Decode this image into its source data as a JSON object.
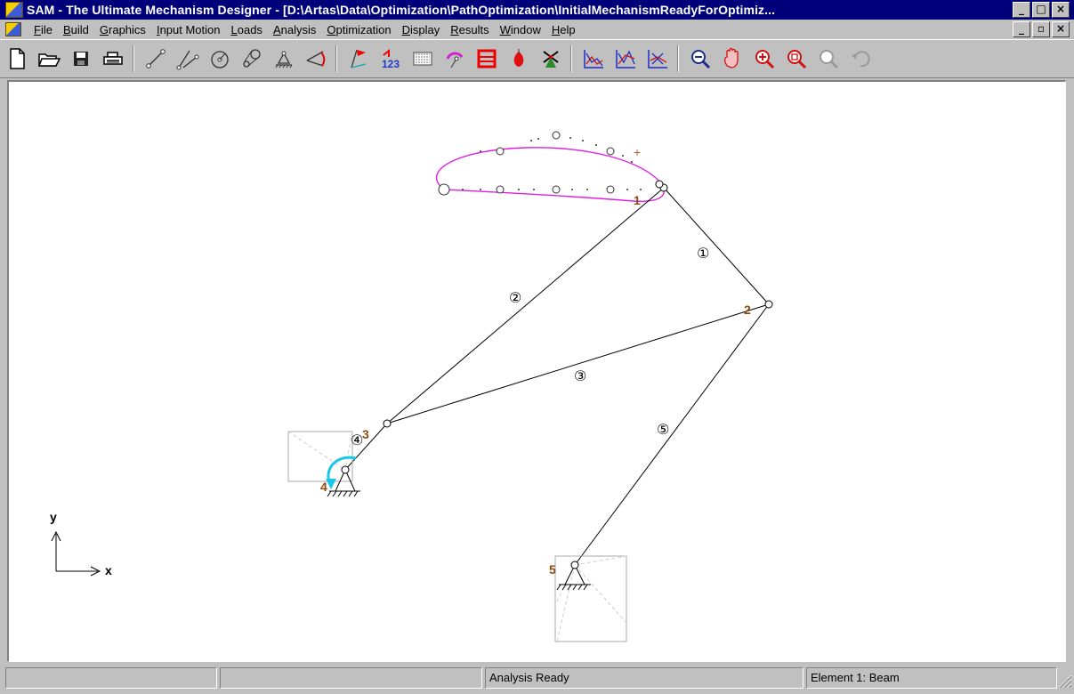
{
  "window": {
    "title": "SAM - The Ultimate Mechanism Designer - [D:\\Artas\\Data\\Optimization\\PathOptimization\\InitialMechanismReadyForOptimiz...",
    "minimize_glyph": "_",
    "maximize_glyph": "□",
    "close_glyph": "×",
    "restore_glyph": "▫"
  },
  "menubar": {
    "items": [
      {
        "accel": "F",
        "rest": "ile"
      },
      {
        "accel": "B",
        "rest": "uild"
      },
      {
        "accel": "G",
        "rest": "raphics"
      },
      {
        "accel": "I",
        "rest": "nput Motion"
      },
      {
        "accel": "L",
        "rest": "oads"
      },
      {
        "accel": "A",
        "rest": "nalysis"
      },
      {
        "accel": "O",
        "rest": "ptimization"
      },
      {
        "accel": "D",
        "rest": "isplay"
      },
      {
        "accel": "R",
        "rest": "esults"
      },
      {
        "accel": "W",
        "rest": "indow"
      },
      {
        "accel": "H",
        "rest": "elp"
      }
    ]
  },
  "toolbar": {
    "buttons": [
      "new-file-icon",
      "open-folder-icon",
      "save-disk-icon",
      "print-icon",
      "beam-element-icon",
      "slider-element-icon",
      "gear-element-icon",
      "belt-element-icon",
      "fixed-support-icon",
      "angle-constraint-icon",
      "node-flag-icon",
      "numbering-icon",
      "hatch-pattern-icon",
      "input-motion-icon",
      "load-frame-icon",
      "spring-damper-icon",
      "windmill-icon",
      "graph-icon",
      "graph-two-icon",
      "graph-three-icon",
      "zoom-out-icon",
      "pan-hand-icon",
      "zoom-in-icon",
      "zoom-window-icon",
      "zoom-previous-icon",
      "undo-icon"
    ]
  },
  "canvas": {
    "node_labels": [
      "1",
      "2",
      "3",
      "4",
      "5"
    ],
    "element_labels": [
      "①",
      "②",
      "③",
      "④",
      "⑤"
    ],
    "axis_y": "y",
    "axis_x": "x",
    "trace_marker": "+",
    "colors": {
      "coupler_curve": "#e020e0",
      "input_arrow": "#18c8e8",
      "node_label": "#8b4a10",
      "link": "#000000"
    }
  },
  "statusbar": {
    "panels": [
      "",
      "",
      "Analysis Ready",
      "Element 1: Beam"
    ]
  }
}
